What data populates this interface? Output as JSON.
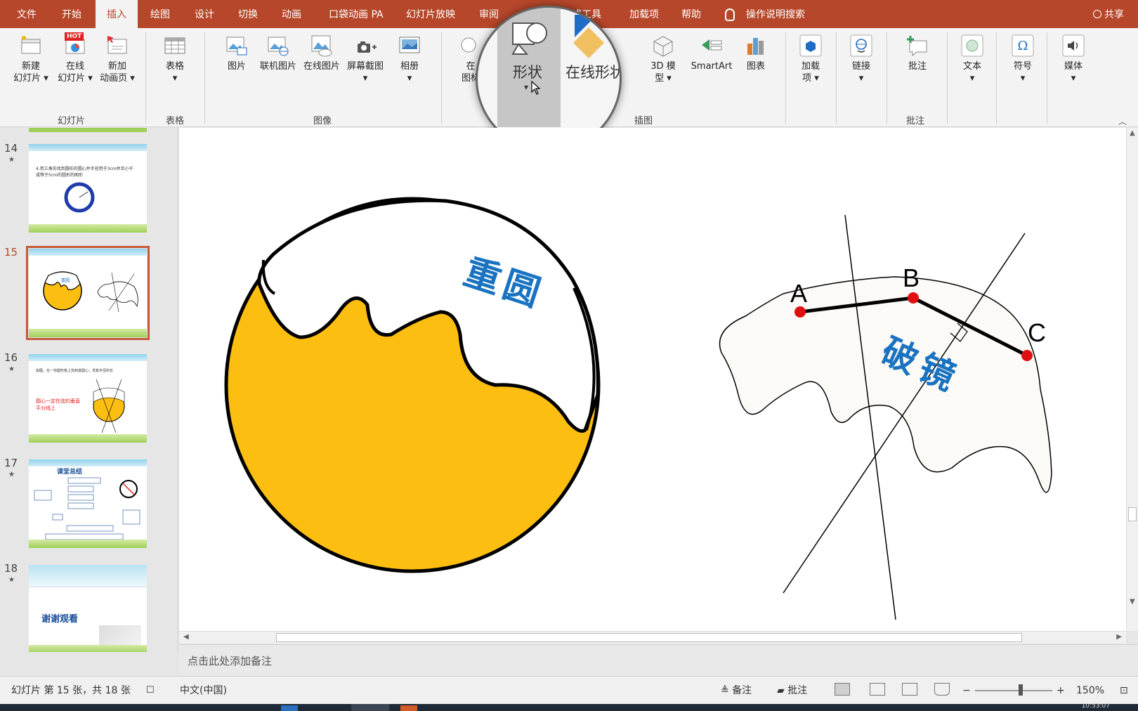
{
  "tabs": [
    "文件",
    "开始",
    "插入",
    "绘图",
    "设计",
    "切换",
    "动画",
    "口袋动画 PA",
    "幻灯片放映",
    "审阅",
    "格式工具",
    "加载项",
    "帮助"
  ],
  "active_tab": "插入",
  "tell_me": "操作说明搜索",
  "share": "共享",
  "ribbon": {
    "new_slide": "新建\n幻灯片 ▾",
    "online_slide": "在线\n幻灯片 ▾",
    "hot_badge": "HOT",
    "new_anim_page": "新加\n动画页 ▾",
    "group_slides": "幻灯片",
    "table": "表格\n▾",
    "group_table": "表格",
    "picture": "图片",
    "online_pictures_linked": "联机图片",
    "online_pictures": "在线图片",
    "screenshot": "屏幕截图\n▾",
    "album": "相册\n▾",
    "group_images": "图像",
    "online_icons_partial": "在\n图标",
    "icons_partial": "图\n标",
    "model_3d": "3D 模\n型 ▾",
    "smartart": "SmartArt",
    "chart": "图表",
    "group_illustrations": "插图",
    "addins": "加载\n项 ▾",
    "link": "链接\n▾",
    "comment": "批注",
    "group_comments": "批注",
    "text": "文本\n▾",
    "symbols": "符号\n▾",
    "media": "媒体\n▾"
  },
  "magnifier": {
    "shapes": "形状",
    "shapes_caret": "▾",
    "online_shapes": "在线形状"
  },
  "thumbnails": [
    {
      "num": "14",
      "star": "★",
      "text": "4.用三角形找到圆形的圆心并半径用于3cm并且小于\n或等于5cm的圆形的图形"
    },
    {
      "num": "15",
      "star": "★",
      "text": "重圆"
    },
    {
      "num": "16",
      "star": "★",
      "text": "如图，在一块圆形板上找到其圆心，求其半径的长",
      "red_text": "圆心一定在弦的垂直\n平分线上"
    },
    {
      "num": "17",
      "star": "★",
      "text": "课堂总结"
    },
    {
      "num": "18",
      "star": "★",
      "text": "谢谢观看"
    }
  ],
  "slide": {
    "left_label": "重圆",
    "right_label": "破镜",
    "point_a": "A",
    "point_b": "B",
    "point_c": "C",
    "colors": {
      "fill_yellow": "#fdbe12",
      "label_blue": "#1a73c1",
      "point_red": "#e01010"
    }
  },
  "notes_placeholder": "点击此处添加备注",
  "status": {
    "slide_info": "幻灯片 第 15 张，共 18 张",
    "language": "中文(中国)",
    "notes": "备注",
    "comments": "批注",
    "zoom_minus": "−",
    "zoom_plus": "+",
    "zoom": "150%"
  },
  "taskbar_time": "10:53:07"
}
